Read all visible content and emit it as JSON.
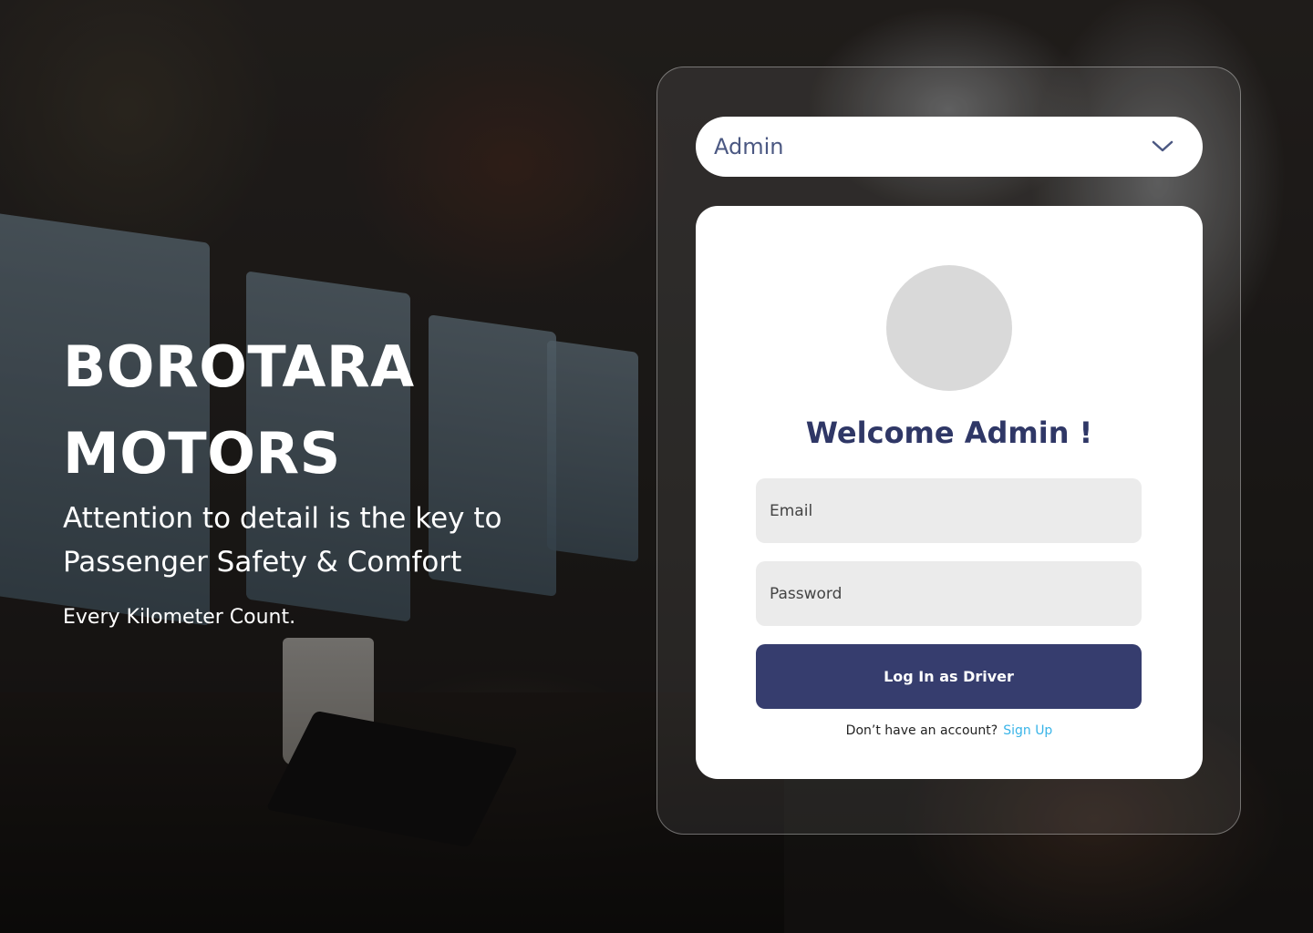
{
  "hero": {
    "brand_line1": "BOROTARA",
    "brand_line2": "MOTORS",
    "tagline": "Attention to detail is the key to Passenger Safety & Comfort",
    "subtitle": "Every Kilometer Count."
  },
  "role_select": {
    "value": "Admin",
    "icon": "chevron-down-icon"
  },
  "login_card": {
    "welcome": "Welcome Admin !",
    "email_placeholder": "Email",
    "password_placeholder": "Password",
    "login_button": "Log In as Driver",
    "signup_prompt": "Don’t have an account?",
    "signup_link": "Sign Up"
  },
  "colors": {
    "primary": "#363d6e",
    "heading": "#2f3766",
    "link": "#39b4e8",
    "input_bg": "#ebebeb",
    "avatar_placeholder": "#d9d9d9"
  }
}
